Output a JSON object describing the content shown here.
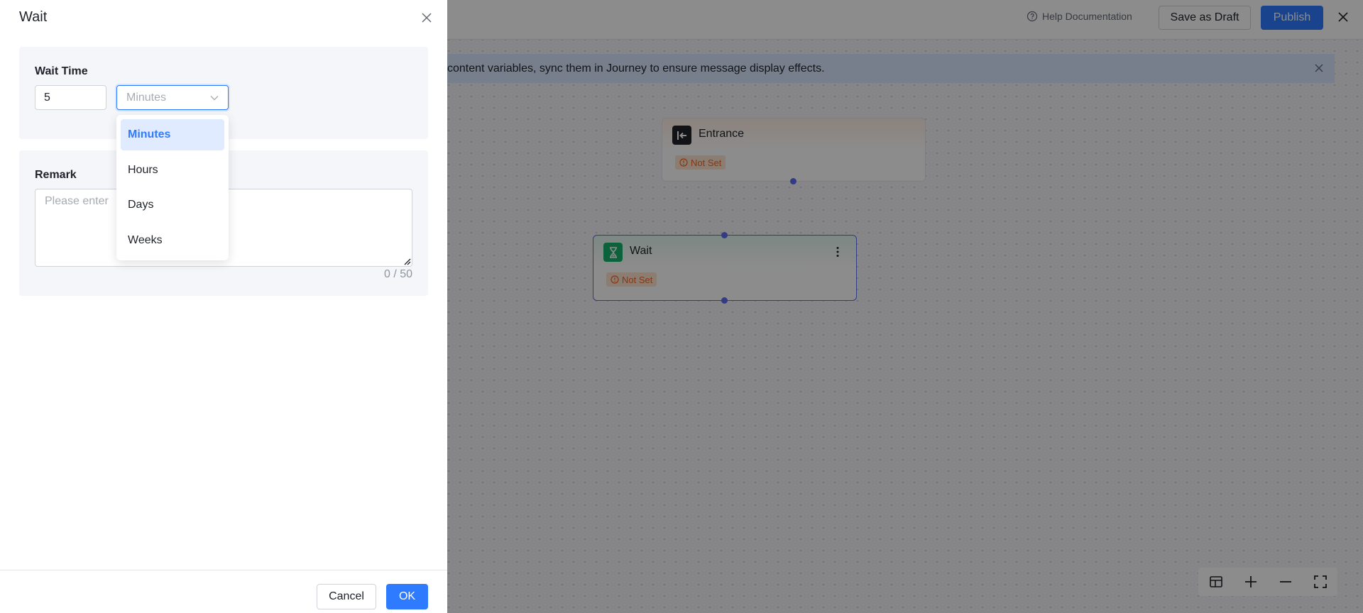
{
  "header": {
    "help_label": "Help Documentation",
    "save_draft_label": "Save as Draft",
    "publish_label": "Publish"
  },
  "notice": {
    "text": "content variables, sync them in Journey to ensure message display effects."
  },
  "canvas": {
    "nodes": [
      {
        "title": "Entrance",
        "badge": "Not Set",
        "icon": "entrance-icon"
      },
      {
        "title": "Wait",
        "badge": "Not Set",
        "icon": "hourglass-icon"
      }
    ]
  },
  "drawer": {
    "title": "Wait",
    "wait_time": {
      "label": "Wait Time",
      "value": "5",
      "unit_placeholder": "Minutes",
      "options": [
        "Minutes",
        "Hours",
        "Days",
        "Weeks"
      ],
      "selected_option": "Minutes"
    },
    "remark": {
      "label": "Remark",
      "placeholder": "Please enter",
      "counter": "0 / 50"
    },
    "footer": {
      "cancel_label": "Cancel",
      "ok_label": "OK"
    }
  },
  "colors": {
    "primary": "#2f7bff",
    "overlay": "rgba(0,0,0,0.45)",
    "badge_text": "#f5631e",
    "badge_bg": "#ffe4d1",
    "wait_icon": "#17b26a",
    "port": "#5b6cf0"
  }
}
